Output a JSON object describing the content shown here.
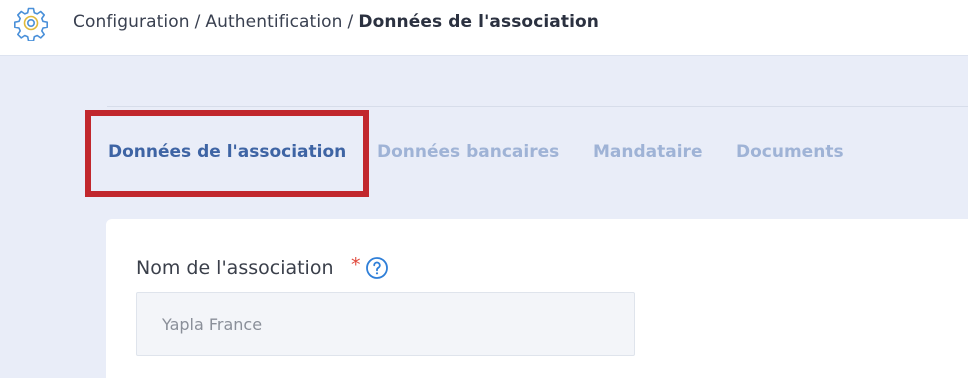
{
  "header": {
    "breadcrumb": [
      {
        "label": "Configuration"
      },
      {
        "label": "Authentification"
      },
      {
        "label": "Données de l'association"
      }
    ],
    "separator": "/"
  },
  "tabs": [
    {
      "label": "Données de l'association",
      "active": true
    },
    {
      "label": "Données bancaires",
      "active": false
    },
    {
      "label": "Mandataire",
      "active": false
    },
    {
      "label": "Documents",
      "active": false
    }
  ],
  "form": {
    "association_name": {
      "label": "Nom de l'association",
      "required_mark": "*",
      "value": "Yapla France"
    }
  },
  "colors": {
    "accent": "#3e64a4",
    "tab_inactive": "#9fb3d6",
    "highlight": "#c1272d",
    "required": "#e0483b",
    "help_icon": "#2f7fd8",
    "gear_icon": "#4a90d9",
    "background": "#e9edf8"
  },
  "icons": {
    "header": "gear-icon",
    "help": "question-circle-icon"
  }
}
